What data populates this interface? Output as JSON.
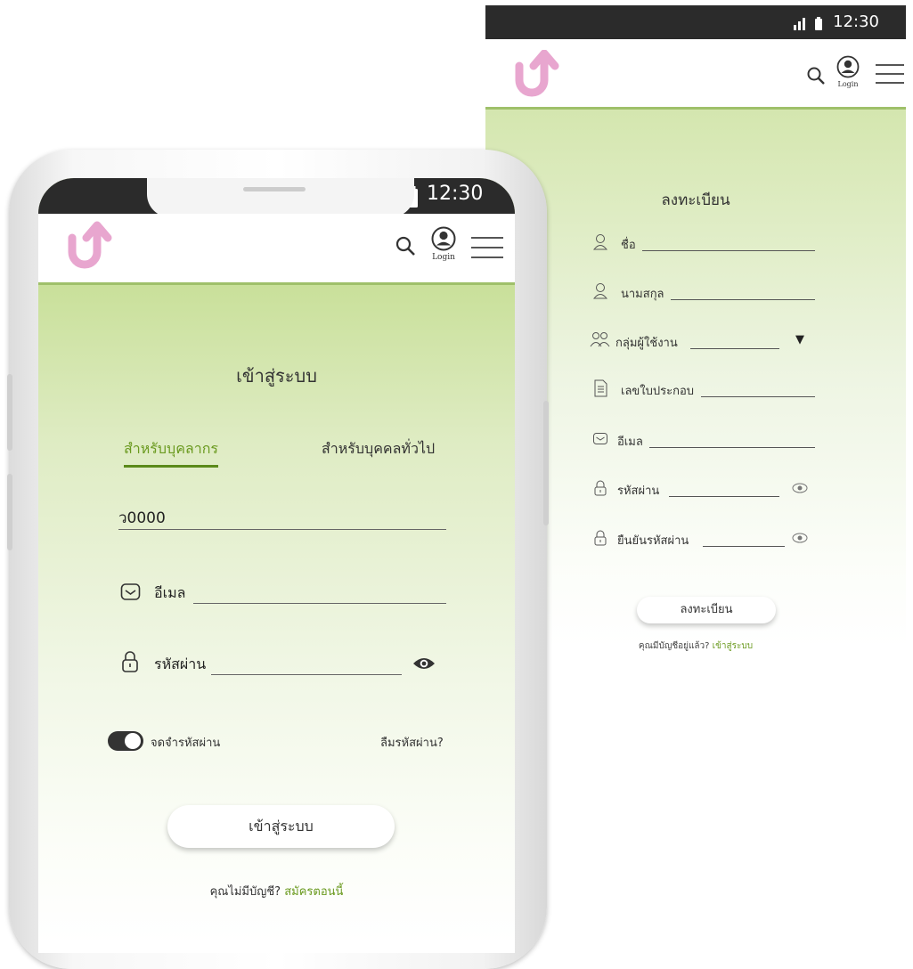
{
  "colors": {
    "accent_green": "#6a9a1f",
    "logo_pink": "#e8a6cf",
    "status_bar": "#2b2b2b"
  },
  "back_screen": {
    "status": {
      "time": "12:30"
    },
    "header": {
      "login_label": "Login",
      "icons": [
        "search-icon",
        "user-icon",
        "menu-icon"
      ]
    },
    "title": "ลงทะเบียน",
    "fields": [
      {
        "label": "ชื่อ",
        "icon": "user-icon"
      },
      {
        "label": "นามสกุล",
        "icon": "user-icon"
      },
      {
        "label": "กลุ่มผู้ใช้งาน",
        "icon": "group-icon",
        "dropdown_arrow": "▼"
      },
      {
        "label": "เลขใบประกอบ",
        "icon": "document-icon"
      },
      {
        "label": "อีเมล",
        "icon": "mail-icon"
      },
      {
        "label": "รหัสผ่าน",
        "icon": "lock-icon"
      },
      {
        "label": "ยืนยันรหัสผ่าน",
        "icon": "lock-icon"
      }
    ],
    "submit_label": "ลงทะเบียน",
    "footer_text": "คุณมีบัญชีอยู่แล้ว?",
    "footer_link": "เข้าสู่ระบบ"
  },
  "front_screen": {
    "status": {
      "time": "12:30"
    },
    "header": {
      "login_label": "Login"
    },
    "title": "เข้าสู่ระบบ",
    "tabs": [
      {
        "label": "สำหรับบุคลากร",
        "active": true
      },
      {
        "label": "สำหรับบุคคลทั่วไป",
        "active": false
      }
    ],
    "id_value": "ว0000",
    "email_label": "อีเมล",
    "password_label": "รหัสผ่าน",
    "remember_label": "จดจำรหัสผ่าน",
    "remember_on": true,
    "forgot_label": "ลืมรหัสผ่าน?",
    "submit_label": "เข้าสู่ระบบ",
    "footer_text": "คุณไม่มีบัญชี?",
    "footer_link": "สมัครตอนนี้"
  }
}
